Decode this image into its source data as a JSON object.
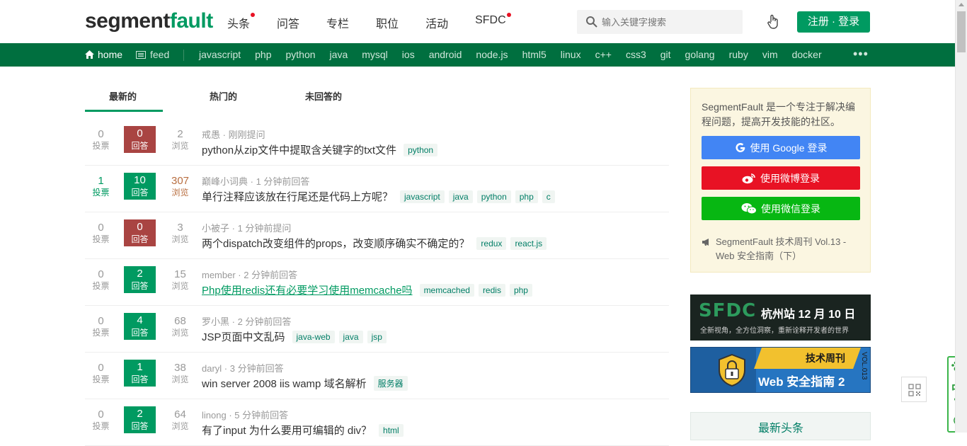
{
  "header": {
    "logo_part1": "segment",
    "logo_part2": "fault",
    "nav": [
      {
        "label": "头条",
        "dot": true
      },
      {
        "label": "问答",
        "dot": false
      },
      {
        "label": "专栏",
        "dot": false
      },
      {
        "label": "职位",
        "dot": false
      },
      {
        "label": "活动",
        "dot": false
      },
      {
        "label": "SFDC",
        "dot": true
      }
    ],
    "search_placeholder": "输入关键字搜索",
    "login_label": "注册 · 登录"
  },
  "tagbar": {
    "home_label": "home",
    "feed_label": "feed",
    "tags": [
      "javascript",
      "php",
      "python",
      "java",
      "mysql",
      "ios",
      "android",
      "node.js",
      "html5",
      "linux",
      "c++",
      "css3",
      "git",
      "golang",
      "ruby",
      "vim",
      "docker"
    ],
    "more_label": "•••"
  },
  "tabs": [
    "最新的",
    "热门的",
    "未回答的"
  ],
  "questions": [
    {
      "votes": "0",
      "votes_label": "投票",
      "answers": "0",
      "answers_label": "回答",
      "views": "2",
      "views_label": "浏览",
      "author": "戒愚",
      "time": "刚刚提问",
      "title": "python从zip文件中提取含关键字的txt文件",
      "tags": [
        "python"
      ]
    },
    {
      "votes": "1",
      "votes_label": "投票",
      "answers": "10",
      "answers_label": "回答",
      "views": "307",
      "views_label": "浏览",
      "author": "巅峰小词典",
      "time": "1 分钟前回答",
      "title": "单行注释应该放在行尾还是代码上方呢？",
      "tags": [
        "javascript",
        "java",
        "python",
        "php",
        "c"
      ]
    },
    {
      "votes": "0",
      "votes_label": "投票",
      "answers": "0",
      "answers_label": "回答",
      "views": "3",
      "views_label": "浏览",
      "author": "小被子",
      "time": "1 分钟前提问",
      "title": "两个dispatch改变组件的props，改变顺序确实不确定的？",
      "tags": [
        "redux",
        "react.js"
      ]
    },
    {
      "votes": "0",
      "votes_label": "投票",
      "answers": "2",
      "answers_label": "回答",
      "views": "15",
      "views_label": "浏览",
      "author": "member",
      "time": "2 分钟前回答",
      "title": "Php使用redis还有必要学习使用memcache吗",
      "tags": [
        "memcached",
        "redis",
        "php"
      ]
    },
    {
      "votes": "0",
      "votes_label": "投票",
      "answers": "4",
      "answers_label": "回答",
      "views": "68",
      "views_label": "浏览",
      "author": "罗小黑",
      "time": "2 分钟前回答",
      "title": "JSP页面中文乱码",
      "tags": [
        "java-web",
        "java",
        "jsp"
      ]
    },
    {
      "votes": "0",
      "votes_label": "投票",
      "answers": "1",
      "answers_label": "回答",
      "views": "38",
      "views_label": "浏览",
      "author": "daryl",
      "time": "3 分钟前回答",
      "title": "win server 2008 iis wamp 域名解析",
      "tags": [
        "服务器"
      ]
    },
    {
      "votes": "0",
      "votes_label": "投票",
      "answers": "2",
      "answers_label": "回答",
      "views": "64",
      "views_label": "浏览",
      "author": "linong",
      "time": "5 分钟前回答",
      "title": "有了input 为什么要用可编辑的 div？",
      "tags": [
        "html"
      ]
    }
  ],
  "sidebar": {
    "intro": "SegmentFault 是一个专注于解决编程问题，提高开发技能的社区。",
    "google_login": "使用 Google 登录",
    "weibo_login": "使用微博登录",
    "wechat_login": "使用微信登录",
    "notice": "SegmentFault 技术周刊 Vol.13 - Web 安全指南（下）",
    "banner1_big": "SFDC",
    "banner1_city": "杭州站  12 月 10 日",
    "banner1_sub": "全新视角，全方位洞察，重新诠释开发者的世界",
    "banner2_title": "技术周刊",
    "banner2_head": "Web 安全指南 2",
    "banner2_vol": "VOL.013",
    "news_head": "最新头条"
  },
  "ime": {
    "label": "中"
  },
  "colors": {
    "brand": "#009a61",
    "tagbar": "#006f3f",
    "zero_answer": "#a94442",
    "google": "#4285f4",
    "weibo": "#e81224",
    "wechat": "#07b712"
  }
}
